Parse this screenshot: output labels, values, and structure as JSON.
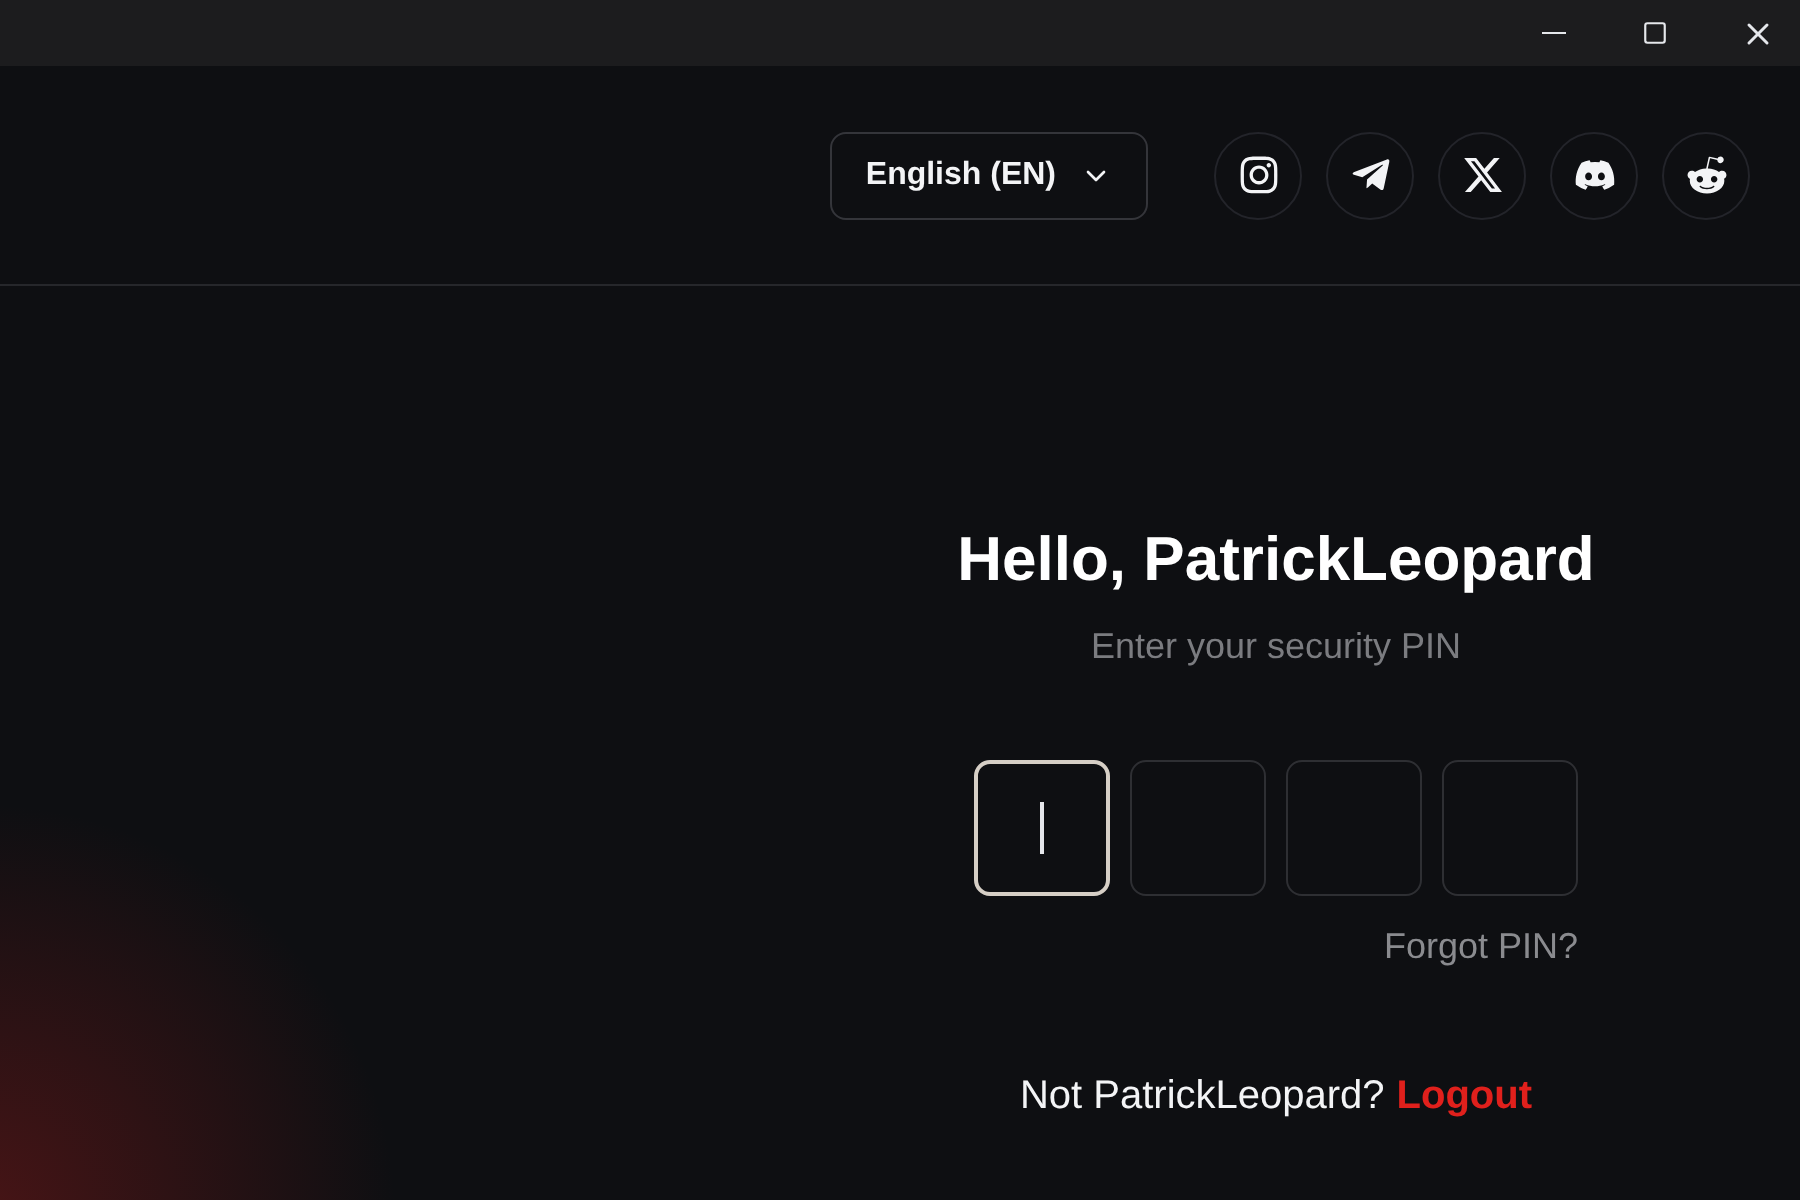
{
  "header": {
    "language": "English (EN)"
  },
  "login": {
    "greeting": "Hello, PatrickLeopard",
    "subtitle": "Enter your security PIN",
    "pin_cells": [
      {
        "focused": true
      },
      {
        "focused": false
      },
      {
        "focused": false
      },
      {
        "focused": false
      }
    ],
    "forgot": "Forgot PIN?",
    "not_user": "Not PatrickLeopard?",
    "logout": "Logout"
  }
}
